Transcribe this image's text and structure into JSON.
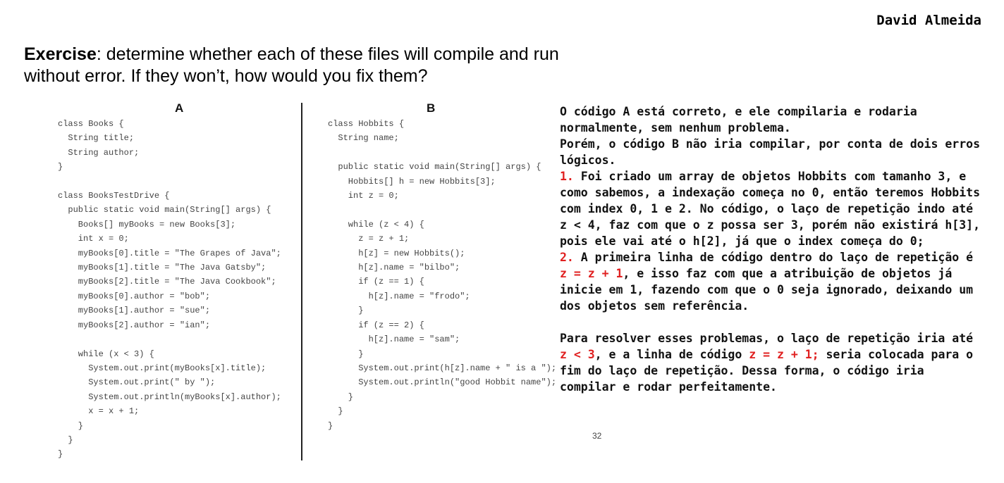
{
  "author": "David Almeida",
  "exercise": {
    "bold": "Exercise",
    "text": ": determine whether each of these files will compile and run without error. If they won’t, how would you fix them?"
  },
  "panel_a": {
    "heading": "A",
    "code": "class Books {\n  String title;\n  String author;\n}\n\nclass BooksTestDrive {\n  public static void main(String[] args) {\n    Books[] myBooks = new Books[3];\n    int x = 0;\n    myBooks[0].title = \"The Grapes of Java\";\n    myBooks[1].title = \"The Java Gatsby\";\n    myBooks[2].title = \"The Java Cookbook\";\n    myBooks[0].author = \"bob\";\n    myBooks[1].author = \"sue\";\n    myBooks[2].author = \"ian\";\n\n    while (x < 3) {\n      System.out.print(myBooks[x].title);\n      System.out.print(\" by \");\n      System.out.println(myBooks[x].author);\n      x = x + 1;\n    }\n  }\n}"
  },
  "panel_b": {
    "heading": "B",
    "code": "class Hobbits {\n  String name;\n\n  public static void main(String[] args) {\n    Hobbits[] h = new Hobbits[3];\n    int z = 0;\n\n    while (z < 4) {\n      z = z + 1;\n      h[z] = new Hobbits();\n      h[z].name = \"bilbo\";\n      if (z == 1) {\n        h[z].name = \"frodo\";\n      }\n      if (z == 2) {\n        h[z].name = \"sam\";\n      }\n      System.out.print(h[z].name + \" is a \");\n      System.out.println(\"good Hobbit name\");\n    }\n  }\n}"
  },
  "answer": {
    "p1": "O código A está correto, e ele compilaria e rodaria normalmente, sem nenhum problema.",
    "p2": "Porém, o código B não iria compilar, por conta de dois erros lógicos.",
    "item1_num": "1.",
    "item1_text": " Foi criado um array de objetos Hobbits com tamanho 3, e como sabemos, a indexação começa no 0, então teremos Hobbits com index 0, 1 e 2. No código, o laço de repetição indo até z < 4, faz com que o z possa ser 3, porém não existirá h[3], pois ele vai até o h[2], já que o index começa do 0;",
    "item2_num": "2.",
    "item2_text_a": " A primeira linha de código dentro do laço de repetição é ",
    "item2_code": "z = z + 1",
    "item2_text_b": ", e isso faz com que a atribuição de objetos já inicie em 1, fazendo com que o 0 seja ignorado, deixando um dos objetos sem referência.",
    "fix_text_a": "Para resolver esses problemas, o laço de repetição iria até ",
    "fix_code_1": "z < 3",
    "fix_text_b": ", e a linha de código ",
    "fix_code_2": "z = z + 1;",
    "fix_text_c": " seria colocada para o fim do laço de repetição. Dessa forma, o código iria compilar e rodar perfeitamente."
  },
  "page_number": "32",
  "colors": {
    "highlight": "#e02020"
  }
}
